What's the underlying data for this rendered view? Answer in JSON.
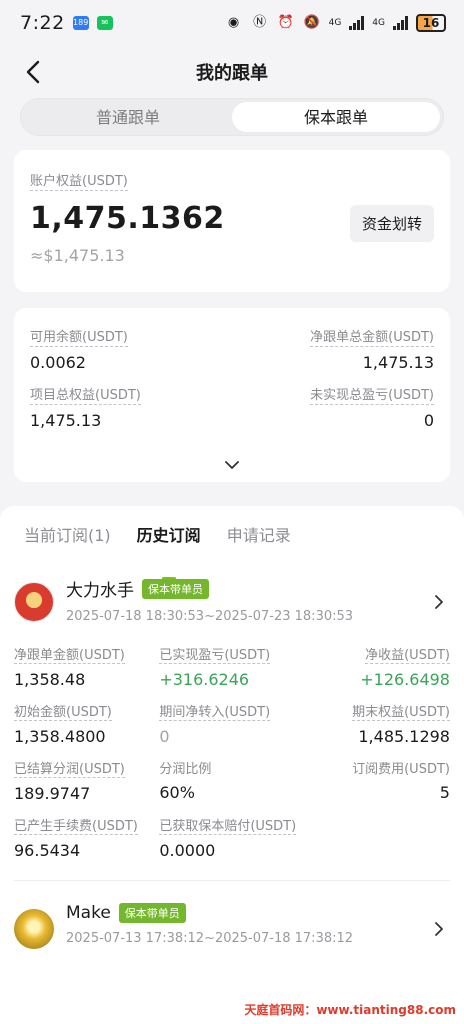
{
  "status": {
    "time": "7:22",
    "badge1": "189",
    "battery": "16",
    "net1": "4G",
    "net2": "4G"
  },
  "header": {
    "title": "我的跟单"
  },
  "segments": [
    {
      "label": "普通跟单"
    },
    {
      "label": "保本跟单"
    }
  ],
  "equity": {
    "label": "账户权益(USDT)",
    "value": "1,475.1362",
    "approx": "≈$1,475.13",
    "transfer_label": "资金划转"
  },
  "stats": {
    "available_label": "可用余额(USDT)",
    "available_value": "0.0062",
    "net_total_label": "净跟单总金额(USDT)",
    "net_total_value": "1,475.13",
    "project_equity_label": "项目总权益(USDT)",
    "project_equity_value": "1,475.13",
    "unrealized_label": "未实现总盈亏(USDT)",
    "unrealized_value": "0"
  },
  "tabs": [
    {
      "label": "当前订阅(1)"
    },
    {
      "label": "历史订阅"
    },
    {
      "label": "申请记录"
    }
  ],
  "subs": [
    {
      "name": "大力水手",
      "badge": "保本带单员",
      "period": "2025-07-18 18:30:53~2025-07-23 18:30:53",
      "net_amount_label": "净跟单金额(USDT)",
      "net_amount": "1,358.48",
      "realized_label": "已实现盈亏(USDT)",
      "realized": "+316.6246",
      "net_profit_label": "净收益(USDT)",
      "net_profit": "+126.6498",
      "initial_label": "初始金额(USDT)",
      "initial": "1,358.4800",
      "transfer_in_label": "期间净转入(USDT)",
      "transfer_in": "0",
      "end_equity_label": "期末权益(USDT)",
      "end_equity": "1,485.1298",
      "settled_label": "已结算分润(USDT)",
      "settled": "189.9747",
      "ratio_label": "分润比例",
      "ratio": "60%",
      "fee_label": "订阅费用(USDT)",
      "fee": "5",
      "trading_fee_label": "已产生手续费(USDT)",
      "trading_fee": "96.5434",
      "compensation_label": "已获取保本赔付(USDT)",
      "compensation": "0.0000"
    },
    {
      "name": "Make",
      "badge": "保本带单员",
      "period": "2025-07-13 17:38:12~2025-07-18 17:38:12"
    }
  ],
  "watermark": "天庭首码网：www.tianting88.com",
  "colors": {
    "accent": "#7cc11a",
    "badge": "#74b72c",
    "positive": "#3aa55a"
  }
}
